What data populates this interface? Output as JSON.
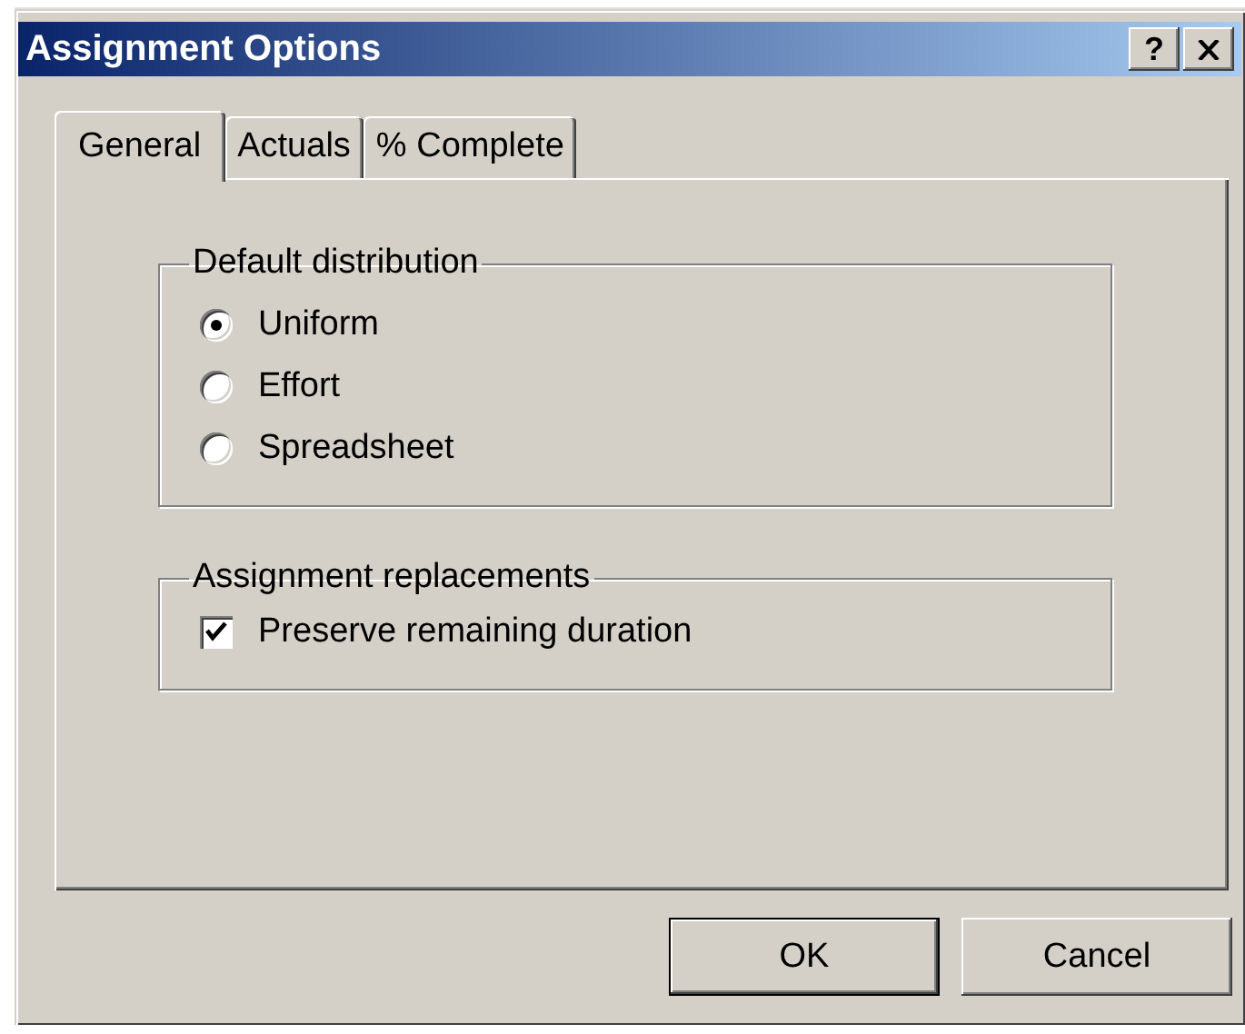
{
  "window": {
    "title": "Assignment Options",
    "title_buttons": [
      {
        "kind": "help",
        "label": "?"
      },
      {
        "kind": "close"
      }
    ]
  },
  "tabs": [
    {
      "label": "General",
      "selected": true
    },
    {
      "label": "Actuals",
      "selected": false
    },
    {
      "label": "% Complete",
      "selected": false
    }
  ],
  "groups": [
    {
      "title": "Default distribution",
      "kind": "radio",
      "options": [
        {
          "label": "Uniform",
          "selected": true
        },
        {
          "label": "Effort",
          "selected": false
        },
        {
          "label": "Spreadsheet",
          "selected": false
        }
      ]
    },
    {
      "title": "Assignment replacements",
      "kind": "checkbox",
      "options": [
        {
          "label": "Preserve remaining duration",
          "checked": true
        }
      ]
    }
  ],
  "buttons": [
    {
      "label": "OK",
      "default": true
    },
    {
      "label": "Cancel",
      "default": false
    }
  ]
}
